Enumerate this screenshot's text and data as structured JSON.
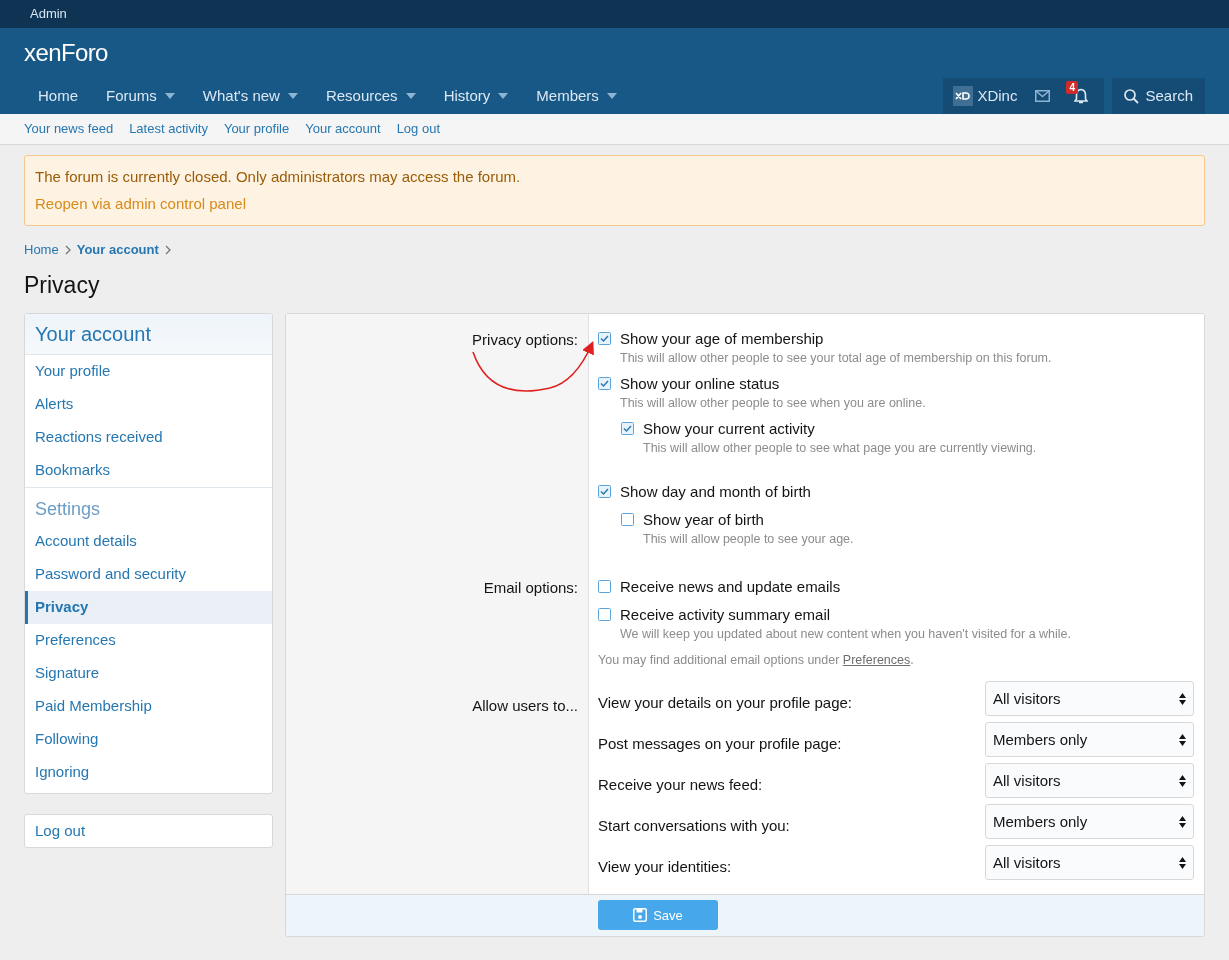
{
  "top_bar": {
    "label": "Admin"
  },
  "header": {
    "logo": "xenForo",
    "nav": [
      {
        "label": "Home",
        "has_menu": false
      },
      {
        "label": "Forums",
        "has_menu": true
      },
      {
        "label": "What's new",
        "has_menu": true
      },
      {
        "label": "Resources",
        "has_menu": true
      },
      {
        "label": "History",
        "has_menu": true
      },
      {
        "label": "Members",
        "has_menu": true
      }
    ],
    "user": {
      "name": "XDinc",
      "alert_count": "4"
    },
    "search": "Search"
  },
  "subnav": [
    "Your news feed",
    "Latest activity",
    "Your profile",
    "Your account",
    "Log out"
  ],
  "notice": {
    "message": "The forum is currently closed. Only administrators may access the forum.",
    "link": "Reopen via admin control panel"
  },
  "breadcrumbs": [
    {
      "label": "Home",
      "current": false
    },
    {
      "label": "Your account",
      "current": true
    }
  ],
  "page_title": "Privacy",
  "sidebar": {
    "groups": [
      {
        "heading": "Your account",
        "kind": "block",
        "items": [
          {
            "label": "Your profile",
            "selected": false
          },
          {
            "label": "Alerts",
            "selected": false
          },
          {
            "label": "Reactions received",
            "selected": false
          },
          {
            "label": "Bookmarks",
            "selected": false
          }
        ]
      },
      {
        "heading": "Settings",
        "kind": "section",
        "items": [
          {
            "label": "Account details",
            "selected": false
          },
          {
            "label": "Password and security",
            "selected": false
          },
          {
            "label": "Privacy",
            "selected": true
          },
          {
            "label": "Preferences",
            "selected": false
          },
          {
            "label": "Signature",
            "selected": false
          },
          {
            "label": "Paid Membership",
            "selected": false
          },
          {
            "label": "Following",
            "selected": false
          },
          {
            "label": "Ignoring",
            "selected": false
          }
        ]
      }
    ],
    "logout": "Log out"
  },
  "form": {
    "rows": [
      {
        "label": "Privacy options:",
        "kind": "checkboxes",
        "groups": [
          [
            {
              "label": "Show your age of membership",
              "hint": "This will allow other people to see your total age of membership on this forum.",
              "checked": true
            },
            {
              "label": "Show your online status",
              "hint": "This will allow other people to see when you are online.",
              "checked": true,
              "children": [
                {
                  "label": "Show your current activity",
                  "hint": "This will allow other people to see what page you are currently viewing.",
                  "checked": true
                }
              ]
            }
          ],
          [
            {
              "label": "Show day and month of birth",
              "checked": true,
              "children": [
                {
                  "label": "Show year of birth",
                  "hint": "This will allow people to see your age.",
                  "checked": false
                }
              ]
            }
          ]
        ]
      },
      {
        "label": "Email options:",
        "kind": "checkboxes",
        "groups": [
          [
            {
              "label": "Receive news and update emails",
              "checked": false
            },
            {
              "label": "Receive activity summary email",
              "hint": "We will keep you updated about new content when you haven't visited for a while.",
              "checked": false
            }
          ]
        ],
        "note": {
          "before": "You may find additional email options under ",
          "link": "Preferences",
          "after": "."
        }
      },
      {
        "label": "Allow users to...",
        "kind": "selects",
        "items": [
          {
            "label": "View your details on your profile page:",
            "value": "All visitors"
          },
          {
            "label": "Post messages on your profile page:",
            "value": "Members only"
          },
          {
            "label": "Receive your news feed:",
            "value": "All visitors"
          },
          {
            "label": "Start conversations with you:",
            "value": "Members only"
          },
          {
            "label": "View your identities:",
            "value": "All visitors"
          }
        ]
      }
    ],
    "submit": "Save"
  }
}
